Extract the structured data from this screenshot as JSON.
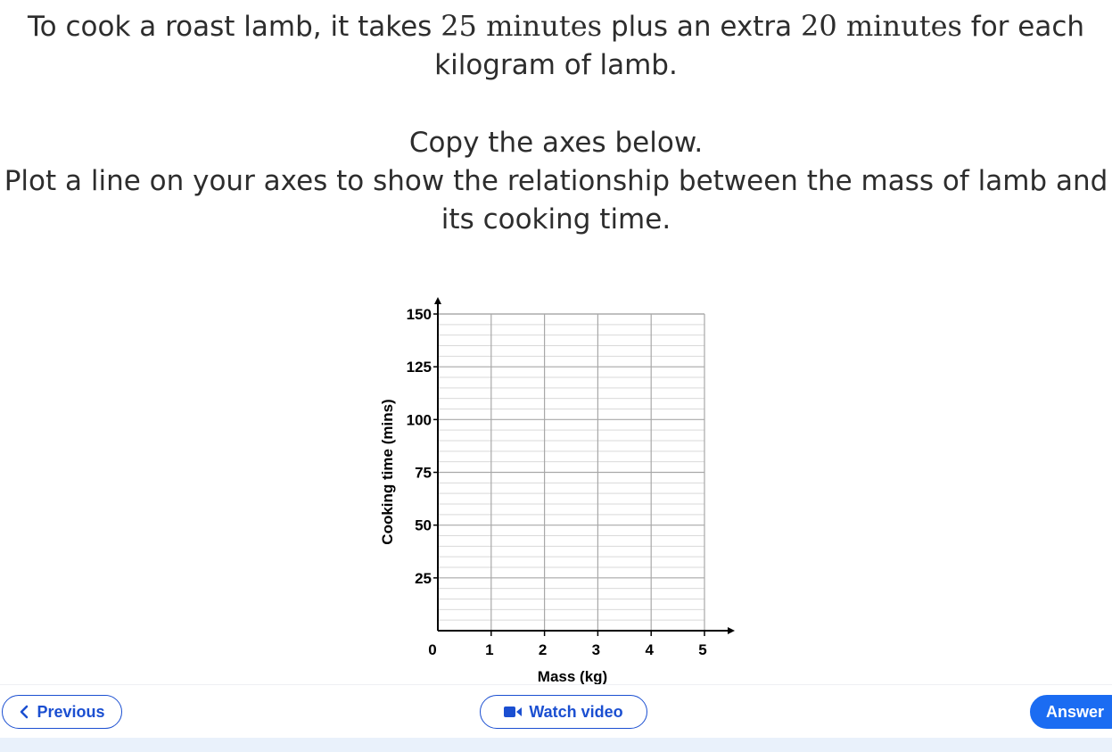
{
  "question": {
    "p1_a": "To cook a roast lamb, it takes ",
    "p1_math1": "25 minutes",
    "p1_b": " plus an extra ",
    "p1_math2": "20 minutes",
    "p1_c": " for each kilogram of lamb.",
    "p2": "Copy the axes below.",
    "p3": "Plot a line on your axes to show the relationship between the mass of lamb and its cooking time."
  },
  "chart_data": {
    "type": "line",
    "xlabel": "Mass (kg)",
    "ylabel": "Cooking time (mins)",
    "xlim": [
      0,
      5
    ],
    "ylim": [
      0,
      150
    ],
    "x_ticks": [
      "0",
      "1",
      "2",
      "3",
      "4",
      "5"
    ],
    "y_ticks": [
      "25",
      "50",
      "75",
      "100",
      "125",
      "150"
    ],
    "grid": true,
    "series": []
  },
  "nav": {
    "previous_label": "Previous",
    "watch_video_label": "Watch video",
    "answer_label": "Answer"
  },
  "colors": {
    "accent": "#1b4fd1",
    "answer_bg": "#1b6cf2",
    "grid": "#c9c9c9"
  },
  "icons": {
    "previous": "chevron-left-icon",
    "video": "video-camera-icon"
  }
}
